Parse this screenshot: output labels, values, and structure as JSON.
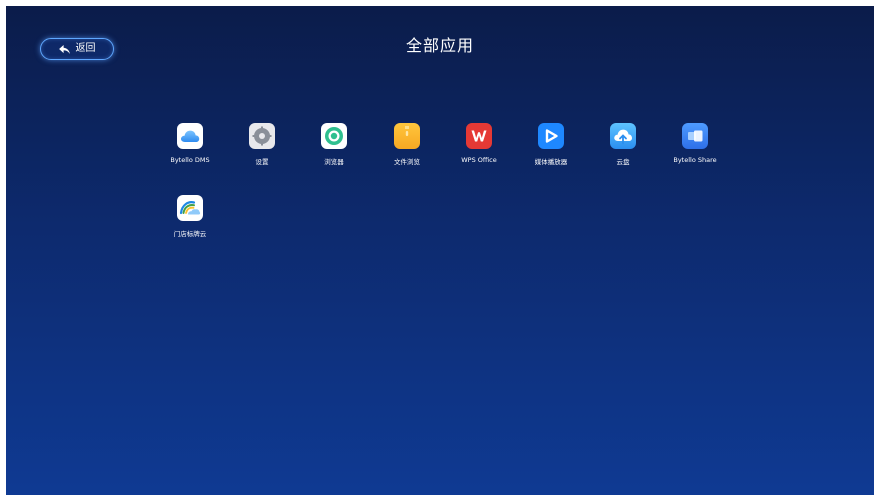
{
  "header": {
    "back_label": "返回",
    "title": "全部应用"
  },
  "apps": [
    {
      "label": "Bytello DMS",
      "icon": "cloud-icon"
    },
    {
      "label": "设置",
      "icon": "gear-icon"
    },
    {
      "label": "浏览器",
      "icon": "browser-icon"
    },
    {
      "label": "文件浏览",
      "icon": "folder-icon"
    },
    {
      "label": "WPS Office",
      "icon": "wps-icon"
    },
    {
      "label": "媒体播放器",
      "icon": "play-icon"
    },
    {
      "label": "云盘",
      "icon": "cloud-upload-icon"
    },
    {
      "label": "Bytello Share",
      "icon": "share-icon"
    },
    {
      "label": "门店标牌云",
      "icon": "signage-cloud-icon"
    }
  ],
  "colors": {
    "background_top": "#0b1c4a",
    "background_bottom": "#0f3a93",
    "accent": "#5fa7ff"
  }
}
